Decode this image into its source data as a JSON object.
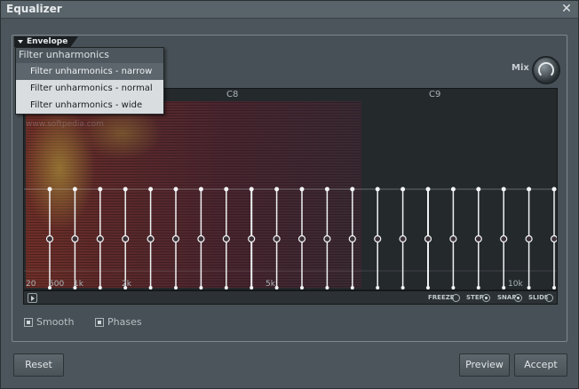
{
  "window": {
    "title": "Equalizer"
  },
  "envelope": {
    "tab_label": "Envelope",
    "menu": {
      "header": "Filter unharmonics",
      "items": [
        "Filter unharmonics - narrow",
        "Filter unharmonics - normal",
        "Filter unharmonics - wide"
      ],
      "highlighted_index": 0
    }
  },
  "mix": {
    "label": "Mix"
  },
  "graph": {
    "note_labels": [
      "C8",
      "C9"
    ],
    "hz_labels": [
      "20",
      "500",
      "1k",
      "2k",
      "5k",
      "10k"
    ],
    "watermark": "www.softpedia.com",
    "band_count": 22
  },
  "strip": {
    "options": [
      {
        "label": "FREEZE",
        "on": false
      },
      {
        "label": "STEP",
        "on": true
      },
      {
        "label": "SNAP",
        "on": true
      },
      {
        "label": "SLIDE",
        "on": false
      }
    ]
  },
  "options": {
    "smooth": "Smooth",
    "phases": "Phases"
  },
  "buttons": {
    "reset": "Reset",
    "preview": "Preview",
    "accept": "Accept"
  }
}
